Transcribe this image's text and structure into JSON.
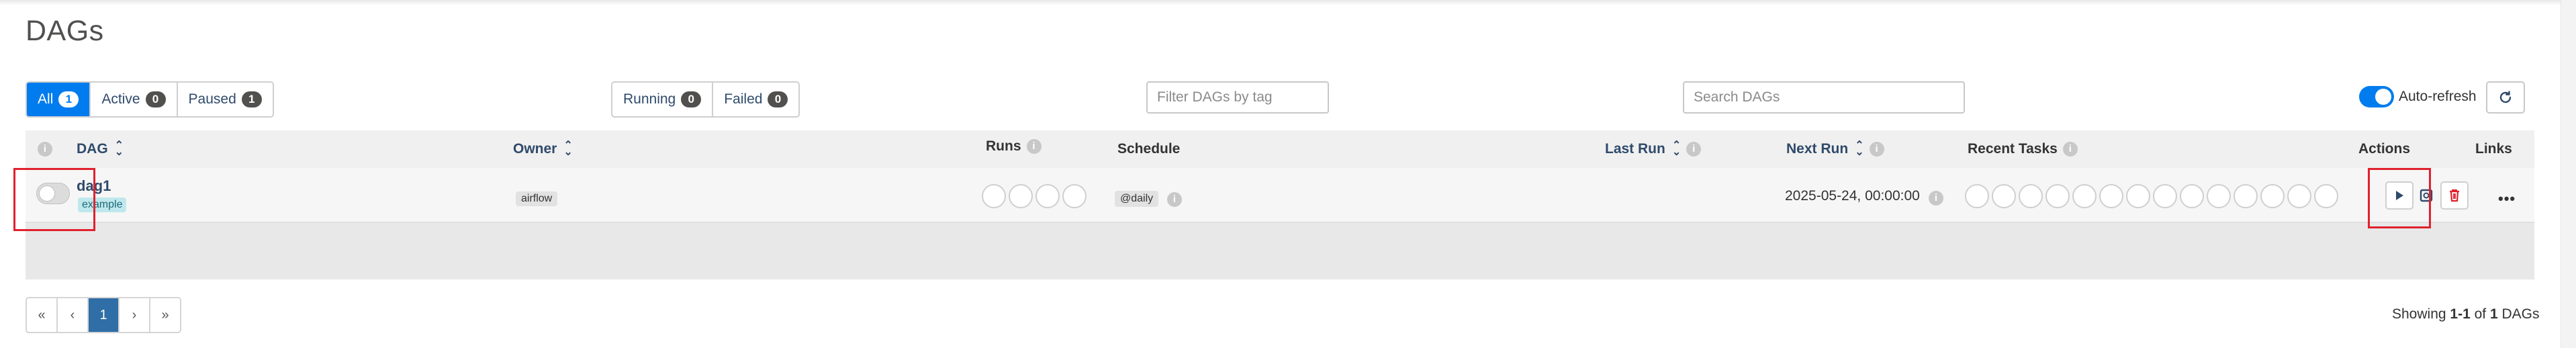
{
  "page": {
    "title": "DAGs"
  },
  "filters": {
    "status_group": [
      {
        "label": "All",
        "count": "1"
      },
      {
        "label": "Active",
        "count": "0"
      },
      {
        "label": "Paused",
        "count": "1"
      }
    ],
    "run_group": [
      {
        "label": "Running",
        "count": "0"
      },
      {
        "label": "Failed",
        "count": "0"
      }
    ],
    "tag_filter_placeholder": "Filter DAGs by tag",
    "search_placeholder": "Search DAGs",
    "auto_refresh_label": "Auto-refresh"
  },
  "table": {
    "headers": {
      "dag": "DAG",
      "owner": "Owner",
      "runs": "Runs",
      "schedule": "Schedule",
      "last_run": "Last Run",
      "next_run": "Next Run",
      "recent_tasks": "Recent Tasks",
      "actions": "Actions",
      "links": "Links"
    },
    "rows": [
      {
        "dag_id": "dag1",
        "tag": "example",
        "owner": "airflow",
        "schedule": "@daily",
        "next_run": "2025-05-24, 00:00:00",
        "paused": true
      }
    ]
  },
  "pagination": {
    "first": "«",
    "prev": "‹",
    "current": "1",
    "next": "›",
    "last": "»",
    "showing_prefix": "Showing",
    "range": "1-1",
    "of": "of",
    "total": "1",
    "suffix": "DAGs"
  },
  "icons": {
    "refresh": "refresh-icon",
    "trigger": "play-icon",
    "refresh_dag": "refresh-dag-icon",
    "delete": "trash-icon",
    "more": "ellipsis-icon"
  },
  "colors": {
    "accent": "#017cee",
    "highlight": "#e0212d",
    "delete": "#e0212d",
    "link": "#2f4a6b"
  }
}
